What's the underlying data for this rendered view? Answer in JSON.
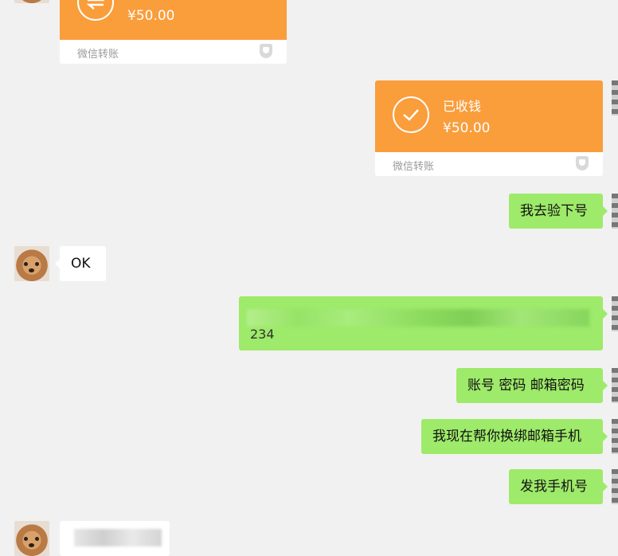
{
  "colors": {
    "background": "#f1f1f1",
    "transfer_orange": "#fa9d3b",
    "sent_bubble_green": "#9eea6a",
    "received_bubble_white": "#ffffff"
  },
  "messages": {
    "transfer_1": {
      "amount": "¥50.00",
      "caption": "微信转账",
      "icon": "transfer-arrows-icon"
    },
    "transfer_2": {
      "status": "已收钱",
      "amount": "¥50.00",
      "caption": "微信转账",
      "icon": "check-circle-icon"
    },
    "msg_verify": "我去验下号",
    "msg_ok": "OK",
    "msg_blurred_suffix": "234",
    "msg_account": "账号 密码 邮箱密码",
    "msg_rebind": "我现在帮你换绑邮箱手机",
    "msg_phone": "发我手机号"
  }
}
